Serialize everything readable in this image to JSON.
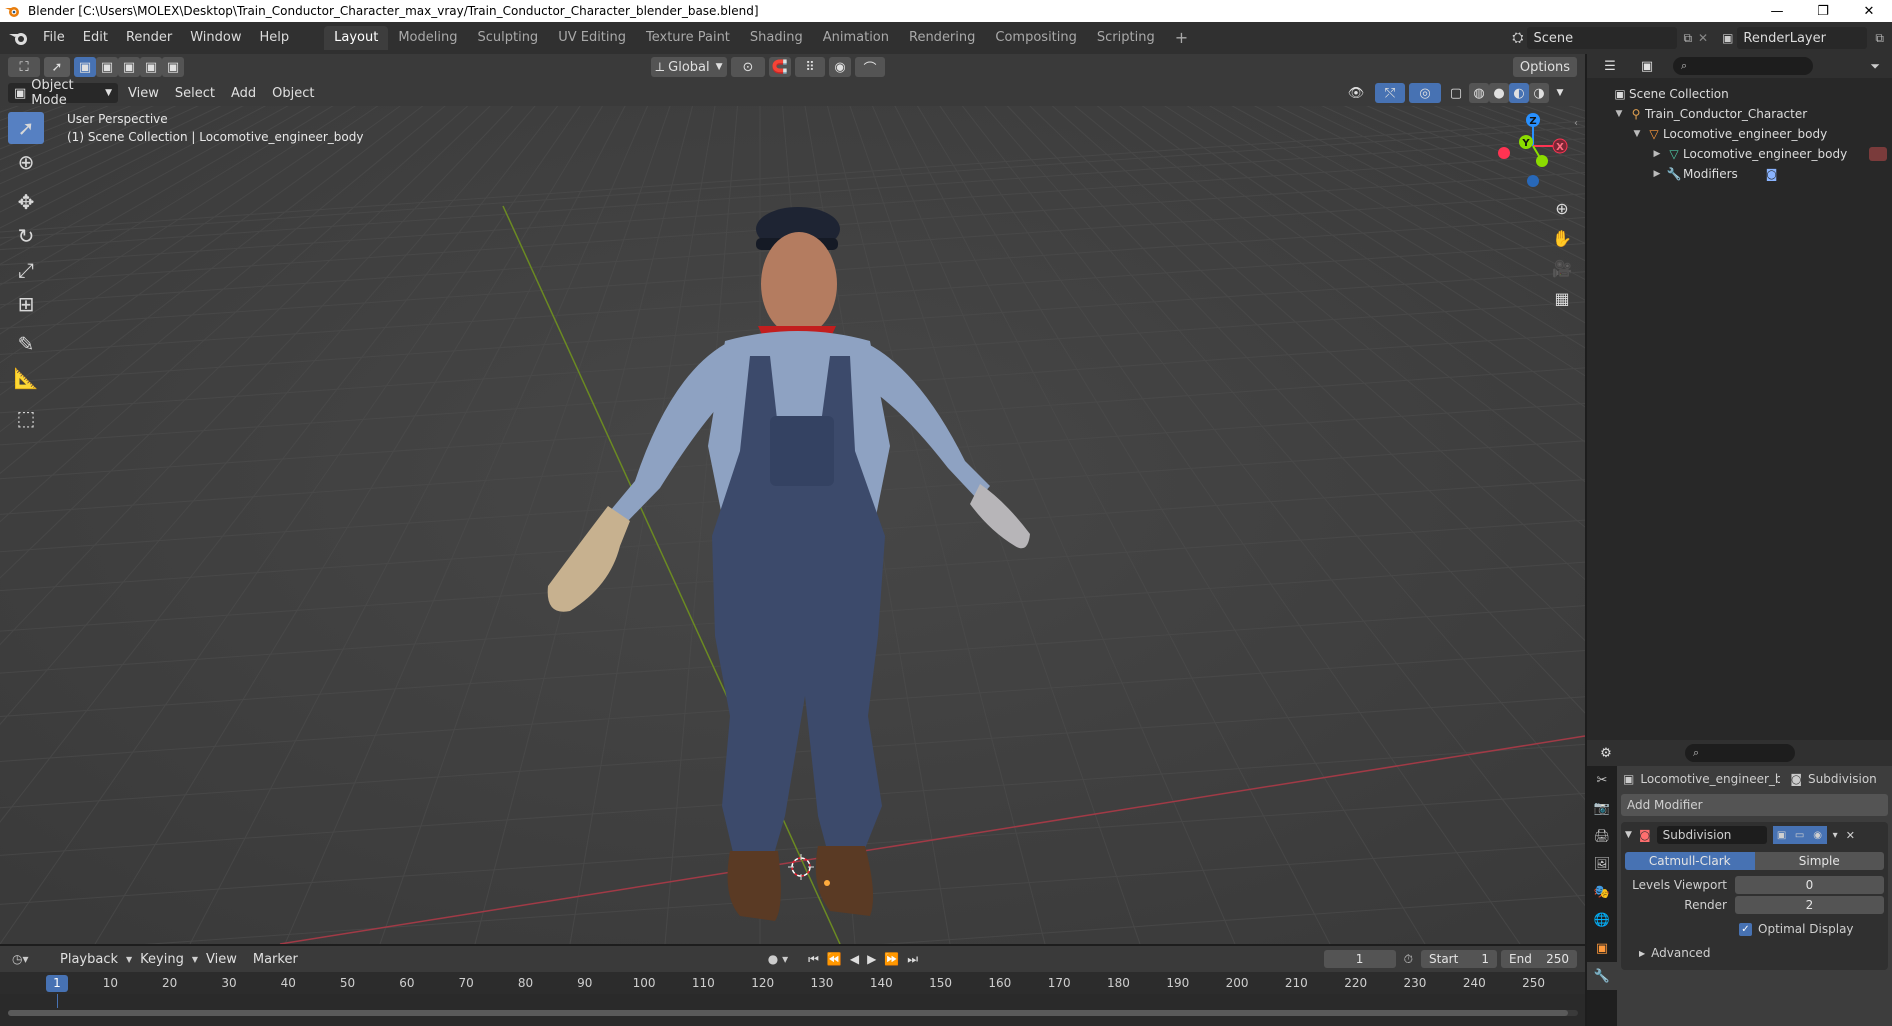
{
  "window": {
    "title": "Blender [C:\\Users\\MOLEX\\Desktop\\Train_Conductor_Character_max_vray/Train_Conductor_Character_blender_base.blend]",
    "minimize": "—",
    "restore": "❐",
    "close": "✕"
  },
  "menu": [
    "File",
    "Edit",
    "Render",
    "Window",
    "Help"
  ],
  "workspaces": [
    "Layout",
    "Modeling",
    "Sculpting",
    "UV Editing",
    "Texture Paint",
    "Shading",
    "Animation",
    "Rendering",
    "Compositing",
    "Scripting"
  ],
  "workspace_add": "+",
  "scene": "Scene",
  "render_layer": "RenderLayer",
  "viewport_header": {
    "mode": "Object Mode",
    "menus": [
      "View",
      "Select",
      "Add",
      "Object"
    ],
    "transform_orientation": "Global",
    "options": "Options"
  },
  "viewport": {
    "perspective": "User Perspective",
    "collection_info": "(1) Scene Collection | Locomotive_engineer_body"
  },
  "gizmo": {
    "z": "Z",
    "y": "Y",
    "x": "X"
  },
  "outliner": {
    "root": "Scene Collection",
    "items": [
      {
        "label": "Train_Conductor_Character",
        "level": 1
      },
      {
        "label": "Locomotive_engineer_body",
        "level": 2
      },
      {
        "label": "Locomotive_engineer_body",
        "level": 3
      },
      {
        "label": "Modifiers",
        "level": 3
      }
    ]
  },
  "properties": {
    "object_name": "Locomotive_engineer_b...",
    "modifier_tab": "Subdivision",
    "add_modifier": "Add Modifier",
    "modifier_name": "Subdivision",
    "catmull": "Catmull-Clark",
    "simple": "Simple",
    "levels_viewport_label": "Levels Viewport",
    "levels_viewport_value": "0",
    "render_label": "Render",
    "render_value": "2",
    "optimal_display": "Optimal Display",
    "advanced": "Advanced"
  },
  "timeline": {
    "menus": [
      "Playback",
      "Keying",
      "View",
      "Marker"
    ],
    "current_frame": "1",
    "start_label": "Start",
    "start_value": "1",
    "end_label": "End",
    "end_value": "250",
    "ticks": [
      "10",
      "20",
      "30",
      "40",
      "50",
      "60",
      "70",
      "80",
      "90",
      "100",
      "110",
      "120",
      "130",
      "140",
      "150",
      "160",
      "170",
      "180",
      "190",
      "200",
      "210",
      "220",
      "230",
      "240",
      "250"
    ]
  },
  "colors": {
    "accent": "#4772b3",
    "x_axis": "#ff3352",
    "y_axis": "#8bdc00",
    "z_axis": "#2890ff"
  }
}
